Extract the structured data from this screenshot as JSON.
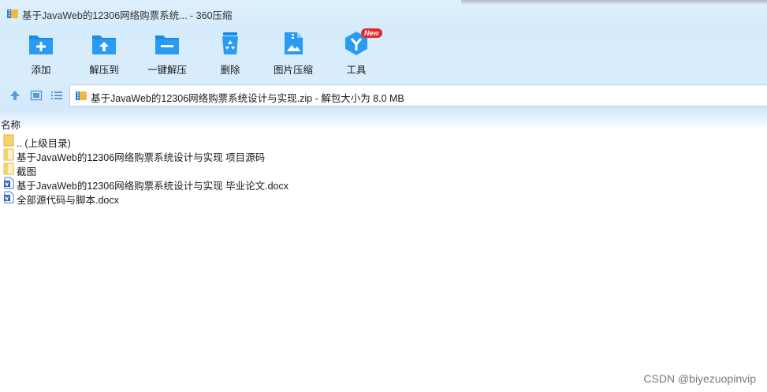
{
  "window": {
    "title": "基于JavaWeb的12306网络购票系统... - 360压缩"
  },
  "toolbar": {
    "items": [
      {
        "label": "添加",
        "icon": "add-folder-icon"
      },
      {
        "label": "解压到",
        "icon": "extract-to-icon"
      },
      {
        "label": "一键解压",
        "icon": "one-click-extract-icon"
      },
      {
        "label": "删除",
        "icon": "recycle-bin-icon"
      },
      {
        "label": "图片压缩",
        "icon": "image-compress-icon"
      },
      {
        "label": "工具",
        "icon": "tools-icon",
        "badge": "New"
      }
    ]
  },
  "navbar": {
    "address": "基于JavaWeb的12306网络购票系统设计与实现.zip - 解包大小为 8.0 MB"
  },
  "list": {
    "column_name": "名称",
    "items": [
      {
        "name": ".. (上级目录)",
        "type": "folder-up"
      },
      {
        "name": "基于JavaWeb的12306网络购票系统设计与实现 项目源码",
        "type": "folder"
      },
      {
        "name": "截图",
        "type": "folder"
      },
      {
        "name": "基于JavaWeb的12306网络购票系统设计与实现 毕业论文.docx",
        "type": "docx"
      },
      {
        "name": "全部源代码与脚本.docx",
        "type": "docx"
      }
    ]
  },
  "watermark": "CSDN @biyezuopinvip",
  "colors": {
    "toolbar_bg": "#d6ebfb",
    "icon_blue": "#1a8ae8",
    "badge_red": "#e8262b",
    "folder_yellow": "#f6d26a"
  }
}
